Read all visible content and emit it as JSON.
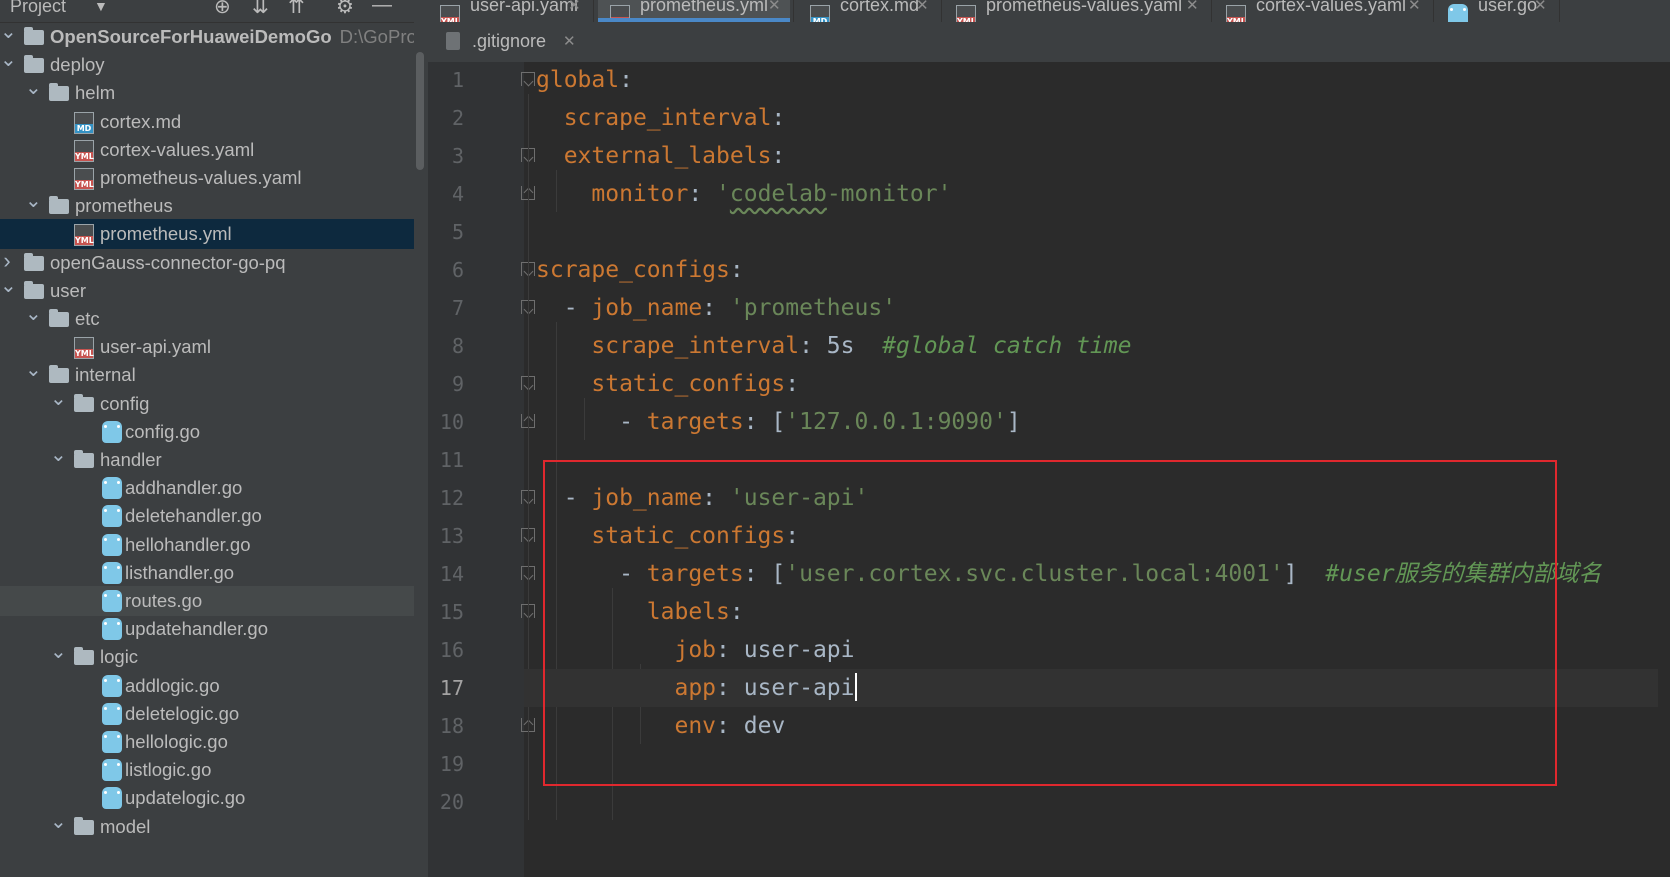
{
  "project_panel": {
    "title": "Project",
    "tree": [
      {
        "label": "OpenSourceForHuaweiDemoGo",
        "path": "D:\\GoProj\\O",
        "type": "root",
        "depth": 0,
        "expanded": true
      },
      {
        "label": "deploy",
        "type": "folder",
        "depth": 0,
        "expanded": true
      },
      {
        "label": "helm",
        "type": "folder",
        "depth": 1,
        "expanded": true
      },
      {
        "label": "cortex.md",
        "type": "md",
        "depth": 2
      },
      {
        "label": "cortex-values.yaml",
        "type": "yml",
        "depth": 2
      },
      {
        "label": "prometheus-values.yaml",
        "type": "yml",
        "depth": 2
      },
      {
        "label": "prometheus",
        "type": "folder",
        "depth": 1,
        "expanded": true
      },
      {
        "label": "prometheus.yml",
        "type": "yml",
        "depth": 2,
        "selected": true
      },
      {
        "label": "openGauss-connector-go-pq",
        "type": "folder",
        "depth": 0,
        "expanded": false
      },
      {
        "label": "user",
        "type": "folder",
        "depth": 0,
        "expanded": true
      },
      {
        "label": "etc",
        "type": "folder",
        "depth": 1,
        "expanded": true
      },
      {
        "label": "user-api.yaml",
        "type": "yml",
        "depth": 2
      },
      {
        "label": "internal",
        "type": "folder",
        "depth": 1,
        "expanded": true
      },
      {
        "label": "config",
        "type": "folder",
        "depth": 2,
        "expanded": true
      },
      {
        "label": "config.go",
        "type": "go",
        "depth": 3
      },
      {
        "label": "handler",
        "type": "folder",
        "depth": 2,
        "expanded": true
      },
      {
        "label": "addhandler.go",
        "type": "go",
        "depth": 3
      },
      {
        "label": "deletehandler.go",
        "type": "go",
        "depth": 3
      },
      {
        "label": "hellohandler.go",
        "type": "go",
        "depth": 3
      },
      {
        "label": "listhandler.go",
        "type": "go",
        "depth": 3
      },
      {
        "label": "routes.go",
        "type": "go",
        "depth": 3,
        "hovered": true
      },
      {
        "label": "updatehandler.go",
        "type": "go",
        "depth": 3
      },
      {
        "label": "logic",
        "type": "folder",
        "depth": 2,
        "expanded": true
      },
      {
        "label": "addlogic.go",
        "type": "go",
        "depth": 3
      },
      {
        "label": "deletelogic.go",
        "type": "go",
        "depth": 3
      },
      {
        "label": "hellologic.go",
        "type": "go",
        "depth": 3
      },
      {
        "label": "listlogic.go",
        "type": "go",
        "depth": 3
      },
      {
        "label": "updatelogic.go",
        "type": "go",
        "depth": 3
      },
      {
        "label": "model",
        "type": "folder",
        "depth": 2,
        "expanded": true
      }
    ]
  },
  "tabs": [
    {
      "label": "user-api.yaml",
      "icon": "yml"
    },
    {
      "label": "prometheus.yml",
      "icon": "yml",
      "active": true
    },
    {
      "label": "cortex.md",
      "icon": "md"
    },
    {
      "label": "prometheus-values.yaml",
      "icon": "yml"
    },
    {
      "label": "cortex-values.yaml",
      "icon": "yml"
    },
    {
      "label": "user.go",
      "icon": "go"
    }
  ],
  "tabs_row2": [
    {
      "label": ".gitignore",
      "icon": "gitignore"
    }
  ],
  "editor": {
    "current_line": 17,
    "lines": [
      [
        {
          "t": "k",
          "v": "global"
        },
        {
          "t": "p",
          "v": ":"
        }
      ],
      [
        {
          "t": "p",
          "v": "  "
        },
        {
          "t": "k",
          "v": "scrape_interval"
        },
        {
          "t": "p",
          "v": ":"
        }
      ],
      [
        {
          "t": "p",
          "v": "  "
        },
        {
          "t": "k",
          "v": "external_labels"
        },
        {
          "t": "p",
          "v": ":"
        }
      ],
      [
        {
          "t": "p",
          "v": "    "
        },
        {
          "t": "k",
          "v": "monitor"
        },
        {
          "t": "p",
          "v": ": "
        },
        {
          "t": "s",
          "v": "'"
        },
        {
          "t": "sq",
          "v": "codelab"
        },
        {
          "t": "s",
          "v": "-monitor'"
        }
      ],
      [],
      [
        {
          "t": "k",
          "v": "scrape_configs"
        },
        {
          "t": "p",
          "v": ":"
        }
      ],
      [
        {
          "t": "p",
          "v": "  - "
        },
        {
          "t": "k",
          "v": "job_name"
        },
        {
          "t": "p",
          "v": ": "
        },
        {
          "t": "s",
          "v": "'prometheus'"
        }
      ],
      [
        {
          "t": "p",
          "v": "    "
        },
        {
          "t": "k",
          "v": "scrape_interval"
        },
        {
          "t": "p",
          "v": ": 5s  "
        },
        {
          "t": "c",
          "v": "#global catch time"
        }
      ],
      [
        {
          "t": "p",
          "v": "    "
        },
        {
          "t": "k",
          "v": "static_configs"
        },
        {
          "t": "p",
          "v": ":"
        }
      ],
      [
        {
          "t": "p",
          "v": "      - "
        },
        {
          "t": "k",
          "v": "targets"
        },
        {
          "t": "p",
          "v": ": ["
        },
        {
          "t": "s",
          "v": "'127.0.0.1:9090'"
        },
        {
          "t": "p",
          "v": "]"
        }
      ],
      [],
      [
        {
          "t": "p",
          "v": "  - "
        },
        {
          "t": "k",
          "v": "job_name"
        },
        {
          "t": "p",
          "v": ": "
        },
        {
          "t": "s",
          "v": "'user-api'"
        }
      ],
      [
        {
          "t": "p",
          "v": "    "
        },
        {
          "t": "k",
          "v": "static_configs"
        },
        {
          "t": "p",
          "v": ":"
        }
      ],
      [
        {
          "t": "p",
          "v": "      - "
        },
        {
          "t": "k",
          "v": "targets"
        },
        {
          "t": "p",
          "v": ": ["
        },
        {
          "t": "s",
          "v": "'user.cortex.svc.cluster.local:4001'"
        },
        {
          "t": "p",
          "v": "]  "
        },
        {
          "t": "c",
          "v": "#user服务的集群内部域名"
        }
      ],
      [
        {
          "t": "p",
          "v": "        "
        },
        {
          "t": "k",
          "v": "labels"
        },
        {
          "t": "p",
          "v": ":"
        }
      ],
      [
        {
          "t": "p",
          "v": "          "
        },
        {
          "t": "k",
          "v": "job"
        },
        {
          "t": "p",
          "v": ": user-api"
        }
      ],
      [
        {
          "t": "p",
          "v": "          "
        },
        {
          "t": "k",
          "v": "app"
        },
        {
          "t": "p",
          "v": ": user-api"
        },
        {
          "t": "cursor",
          "v": ""
        }
      ],
      [
        {
          "t": "p",
          "v": "          "
        },
        {
          "t": "k",
          "v": "env"
        },
        {
          "t": "p",
          "v": ": dev"
        }
      ],
      [],
      []
    ]
  },
  "colors": {
    "keyword": "#cc7832",
    "string": "#6a8759",
    "comment": "#629755",
    "highlight_box": "#e0282e",
    "selection": "#0d293e"
  }
}
